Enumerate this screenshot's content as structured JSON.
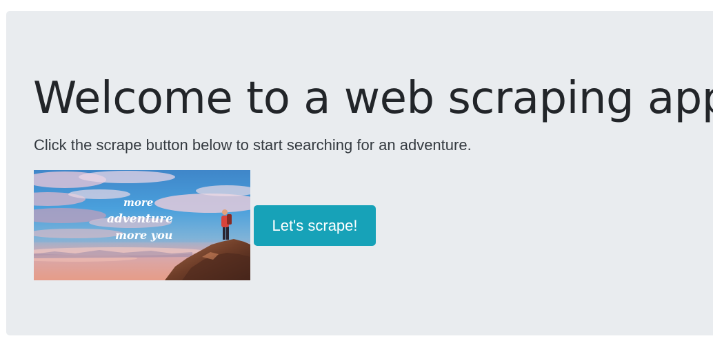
{
  "jumbotron": {
    "title": "Welcome to a web scraping app!",
    "lead": "Click the scrape button below to start searching for an adventure.",
    "image": {
      "overlay_lines": [
        "more",
        "adventure",
        "more you"
      ]
    },
    "button_label": "Let's scrape!"
  },
  "colors": {
    "jumbotron_bg": "#e9ecef",
    "button_bg": "#17a2b8",
    "title_text": "#222529"
  }
}
